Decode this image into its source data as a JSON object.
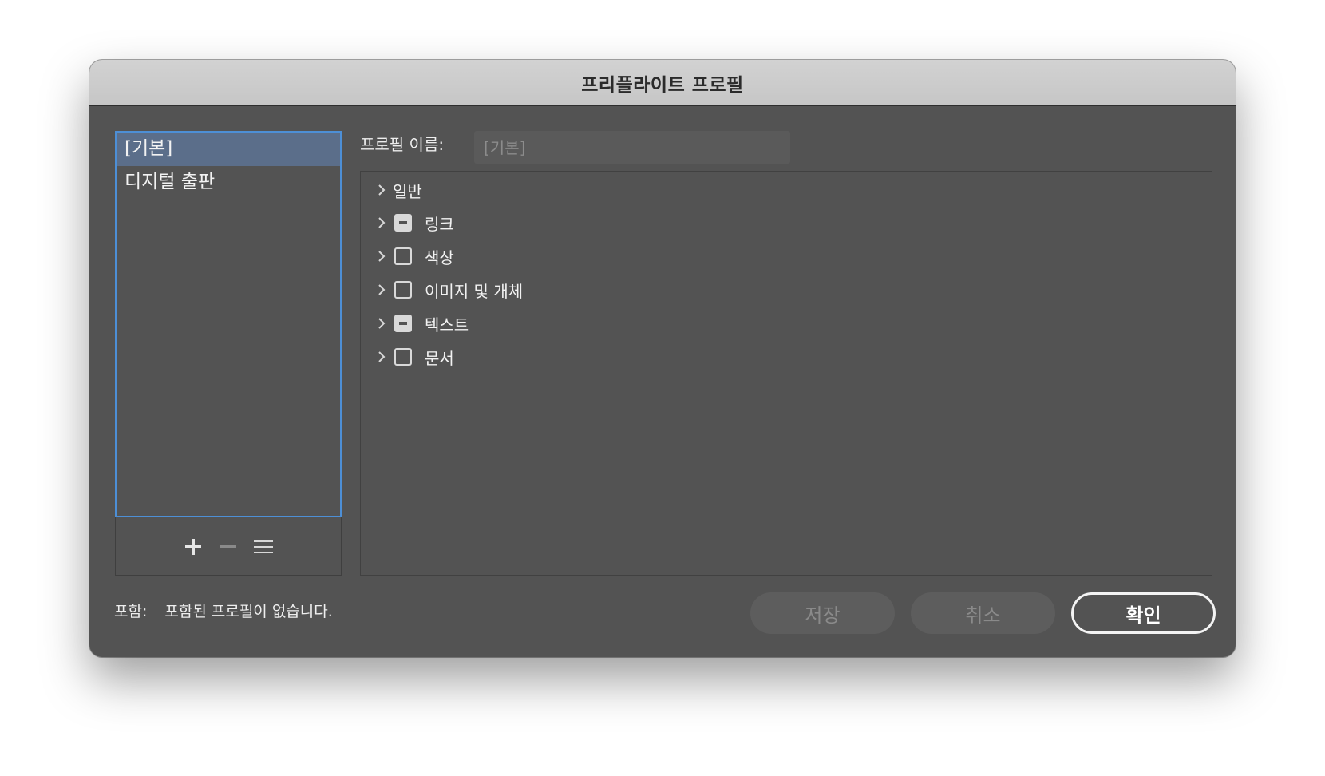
{
  "window": {
    "title": "프리플라이트 프로필"
  },
  "profiles": {
    "items": [
      {
        "label": "[기본]",
        "selected": true
      },
      {
        "label": "디지털 출판",
        "selected": false
      }
    ],
    "toolbar": {
      "add_icon": "plus-icon",
      "remove_icon": "minus-icon",
      "menu_icon": "menu-icon"
    }
  },
  "profile_name": {
    "label": "프로필 이름:",
    "value": "[기본]"
  },
  "categories": [
    {
      "label": "일반",
      "checkbox": "none"
    },
    {
      "label": "링크",
      "checkbox": "mixed"
    },
    {
      "label": "색상",
      "checkbox": "unchecked"
    },
    {
      "label": "이미지 및 개체",
      "checkbox": "unchecked"
    },
    {
      "label": "텍스트",
      "checkbox": "mixed"
    },
    {
      "label": "문서",
      "checkbox": "unchecked"
    }
  ],
  "footer": {
    "embed_label": "포함:",
    "embed_value": "포함된 프로필이 없습니다.",
    "save_label": "저장",
    "cancel_label": "취소",
    "ok_label": "확인"
  },
  "colors": {
    "dialog_bg": "#535353",
    "selection": "#5b6e8a",
    "focus_ring": "#4d8fd6"
  }
}
